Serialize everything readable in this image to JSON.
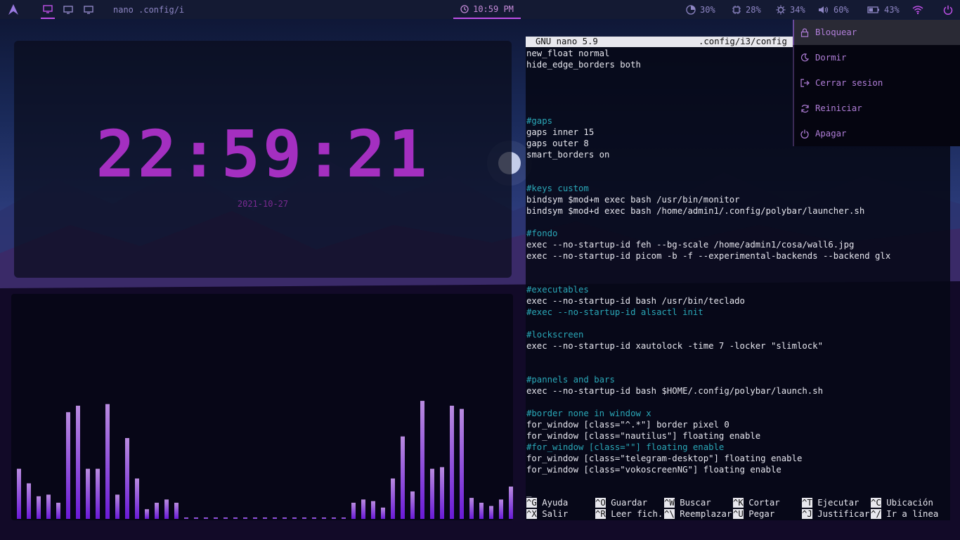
{
  "topbar": {
    "window_title": "nano .config/i",
    "clock": "10:59 PM",
    "stats": [
      {
        "name": "cpu",
        "value": "30%"
      },
      {
        "name": "memory",
        "value": "28%"
      },
      {
        "name": "brightness",
        "value": "34%"
      },
      {
        "name": "volume",
        "value": "60%"
      },
      {
        "name": "battery",
        "value": "43%"
      }
    ]
  },
  "clock_widget": {
    "time": "22:59:21",
    "date": "2021-10-27"
  },
  "visualizer": {
    "bar_levels": [
      0.31,
      0.22,
      0.14,
      0.15,
      0.1,
      0.66,
      0.7,
      0.31,
      0.31,
      0.71,
      0.15,
      0.5,
      0.25,
      0.06,
      0.1,
      0.12,
      0.1,
      0.0,
      0.0,
      0.0,
      0.0,
      0.0,
      0.0,
      0.0,
      0.0,
      0.0,
      0.0,
      0.0,
      0.0,
      0.0,
      0.0,
      0.0,
      0.0,
      0.0,
      0.1,
      0.12,
      0.11,
      0.07,
      0.25,
      0.51,
      0.17,
      0.73,
      0.31,
      0.32,
      0.7,
      0.68,
      0.13,
      0.1,
      0.08,
      0.12,
      0.2
    ]
  },
  "terminal": {
    "header_version": "GNU nano 5.9",
    "header_file": ".config/i3/config",
    "lines": [
      {
        "text": "new_float normal",
        "comment": false
      },
      {
        "text": "hide_edge_borders both",
        "comment": false
      },
      {
        "text": "",
        "comment": false
      },
      {
        "text": "",
        "comment": false
      },
      {
        "text": "",
        "comment": false
      },
      {
        "text": "",
        "comment": false
      },
      {
        "text": "#gaps",
        "comment": true
      },
      {
        "text": "gaps inner 15",
        "comment": false
      },
      {
        "text": "gaps outer 8",
        "comment": false
      },
      {
        "text": "smart_borders on",
        "comment": false
      },
      {
        "text": "",
        "comment": false
      },
      {
        "text": "",
        "comment": false
      },
      {
        "text": "#keys custom",
        "comment": true
      },
      {
        "text": "bindsym $mod+m exec bash /usr/bin/monitor",
        "comment": false
      },
      {
        "text": "bindsym $mod+d exec bash /home/admin1/.config/polybar/launcher.sh",
        "comment": false
      },
      {
        "text": "",
        "comment": false
      },
      {
        "text": "#fondo",
        "comment": true
      },
      {
        "text": "exec --no-startup-id feh --bg-scale /home/admin1/cosa/wall6.jpg",
        "comment": false
      },
      {
        "text": "exec --no-startup-id picom -b -f --experimental-backends --backend glx",
        "comment": false
      },
      {
        "text": "",
        "comment": false
      },
      {
        "text": "",
        "comment": false
      },
      {
        "text": "#executables",
        "comment": true
      },
      {
        "text": "exec --no-startup-id bash /usr/bin/teclado",
        "comment": false
      },
      {
        "text": "#exec --no-startup-id alsactl init",
        "comment": true
      },
      {
        "text": "",
        "comment": false
      },
      {
        "text": "#lockscreen",
        "comment": true
      },
      {
        "text": "exec --no-startup-id xautolock -time 7 -locker \"slimlock\"",
        "comment": false
      },
      {
        "text": "",
        "comment": false
      },
      {
        "text": "",
        "comment": false
      },
      {
        "text": "#pannels and bars",
        "comment": true
      },
      {
        "text": "exec --no-startup-id bash $HOME/.config/polybar/launch.sh",
        "comment": false
      },
      {
        "text": "",
        "comment": false
      },
      {
        "text": "#border none in window x",
        "comment": true
      },
      {
        "text": "for_window [class=\"^.*\"] border pixel 0",
        "comment": false
      },
      {
        "text": "for_window [class=\"nautilus\"] floating enable",
        "comment": false
      },
      {
        "text": "#for_window [class=\"\"] floating enable",
        "comment": true
      },
      {
        "text": "for_window [class=\"telegram-desktop\"] floating enable",
        "comment": false
      },
      {
        "text": "for_window [class=\"vokoscreenNG\"] floating enable",
        "comment": false
      },
      {
        "text": "",
        "comment": false
      },
      {
        "text": "_",
        "comment": false
      }
    ],
    "shortcuts": [
      [
        {
          "key": "^G",
          "label": "Ayuda"
        },
        {
          "key": "^O",
          "label": "Guardar"
        },
        {
          "key": "^W",
          "label": "Buscar"
        },
        {
          "key": "^K",
          "label": "Cortar"
        },
        {
          "key": "^T",
          "label": "Ejecutar"
        },
        {
          "key": "^C",
          "label": "Ubicación"
        }
      ],
      [
        {
          "key": "^X",
          "label": "Salir"
        },
        {
          "key": "^R",
          "label": "Leer fich."
        },
        {
          "key": "^\\",
          "label": "Reemplazar"
        },
        {
          "key": "^U",
          "label": "Pegar"
        },
        {
          "key": "^J",
          "label": "Justificar"
        },
        {
          "key": "^/",
          "label": "Ir a línea"
        }
      ]
    ]
  },
  "power_menu": {
    "items": [
      {
        "label": "Bloquear",
        "icon": "lock-icon",
        "selected": true
      },
      {
        "label": "Dormir",
        "icon": "moon-icon",
        "selected": false
      },
      {
        "label": "Cerrar sesion",
        "icon": "logout-icon",
        "selected": false
      },
      {
        "label": "Reiniciar",
        "icon": "refresh-icon",
        "selected": false
      },
      {
        "label": "Apagar",
        "icon": "power-icon",
        "selected": false
      }
    ]
  },
  "colors": {
    "accent": "#c050e8",
    "clock_digits": "#a42fc0",
    "comment": "#2aa8b8",
    "menu_text": "#b07ed8",
    "bar_top": "#b98be0",
    "bar_bottom": "#6a1ad8"
  }
}
